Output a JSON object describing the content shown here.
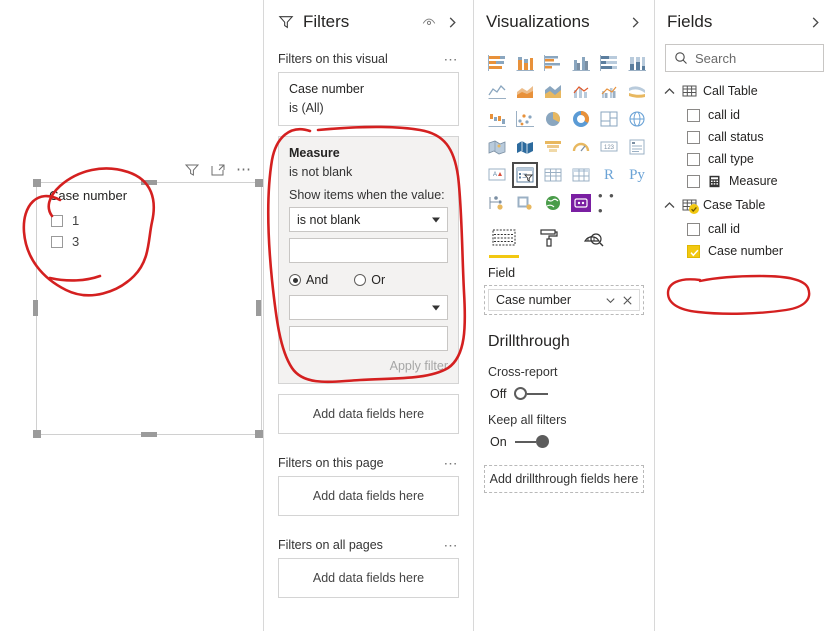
{
  "canvas": {
    "visual_header_icons": [
      "filter-icon",
      "focus-mode-icon",
      "more-options-icon"
    ],
    "slicer": {
      "title": "Case number",
      "items": [
        {
          "label": "1",
          "checked": false
        },
        {
          "label": "3",
          "checked": false
        }
      ]
    }
  },
  "filters": {
    "title": "Filters",
    "header_icons": [
      "eye-icon",
      "expand-chevron-icon"
    ],
    "sections": [
      {
        "label": "Filters on this visual"
      },
      {
        "label": "Filters on this page"
      },
      {
        "label": "Filters on all pages"
      }
    ],
    "visual_cards": [
      {
        "name": "Case number",
        "summary": "is (All)"
      }
    ],
    "expanded_card": {
      "name": "Measure",
      "summary": "is not blank",
      "condition_label": "Show items when the value:",
      "operator1": "is not blank",
      "value1": "",
      "logic": {
        "and_label": "And",
        "or_label": "Or",
        "selected": "And"
      },
      "operator2": "",
      "value2": "",
      "apply_label": "Apply filter"
    },
    "dropzone_label": "Add data fields here",
    "page_dropzone_label": "Add data fields here",
    "all_pages_dropzone_label": "Add data fields here"
  },
  "visualizations": {
    "title": "Visualizations",
    "header_icons": [
      "expand-chevron-icon"
    ],
    "gallery": [
      "stacked-bar-chart",
      "stacked-column-chart",
      "clustered-bar-chart",
      "clustered-column-chart",
      "100-stacked-bar-chart",
      "100-stacked-column-chart",
      "line-chart",
      "area-chart",
      "stacked-area-chart",
      "line-stacked-column-chart",
      "line-clustered-column-chart",
      "ribbon-chart",
      "waterfall-chart",
      "scatter-chart",
      "pie-chart",
      "donut-chart",
      "treemap",
      "map",
      "filled-map",
      "shape-map",
      "funnel",
      "gauge",
      "card",
      "multi-row-card",
      "kpi",
      "slicer",
      "table",
      "matrix",
      "r-script-visual",
      "python-visual",
      "key-influencers",
      "decomposition-tree",
      "arcgis-map",
      "smart-narrative",
      "more-visuals"
    ],
    "selected_visual": "slicer",
    "r_label": "R",
    "py_label": "Py",
    "more_label": "• • •",
    "tabs": [
      {
        "name": "fields-tab",
        "icon": "fields-pane-icon",
        "selected": true
      },
      {
        "name": "format-tab",
        "icon": "paint-roller-icon",
        "selected": false
      },
      {
        "name": "analytics-tab",
        "icon": "analytics-magnifier-icon",
        "selected": false
      }
    ],
    "well": {
      "label": "Field",
      "chip": {
        "text": "Case number",
        "icons": [
          "chevron-down-icon",
          "remove-icon"
        ]
      }
    },
    "drillthrough": {
      "title": "Drillthrough",
      "cross_report": {
        "label": "Cross-report",
        "state": "Off",
        "on": false
      },
      "keep_all_filters": {
        "label": "Keep all filters",
        "state": "On",
        "on": true
      },
      "dropzone_label": "Add drillthrough fields here"
    }
  },
  "fields": {
    "title": "Fields",
    "header_icons": [
      "expand-chevron-icon"
    ],
    "search": {
      "placeholder": "Search",
      "value": ""
    },
    "tables": [
      {
        "name": "Call Table",
        "expanded": true,
        "badge": false,
        "fields": [
          {
            "name": "call id",
            "checked": false,
            "measure": false
          },
          {
            "name": "call status",
            "checked": false,
            "measure": false
          },
          {
            "name": "call type",
            "checked": false,
            "measure": false
          },
          {
            "name": "Measure",
            "checked": false,
            "measure": true
          }
        ]
      },
      {
        "name": "Case Table",
        "expanded": true,
        "badge": true,
        "fields": [
          {
            "name": "call id",
            "checked": false,
            "measure": false
          },
          {
            "name": "Case number",
            "checked": true,
            "measure": false
          }
        ]
      }
    ]
  },
  "annotations": {
    "color": "#d42020",
    "shapes": [
      "circle-slicer-visual",
      "circle-measure-filter-card",
      "circle-case-number-field"
    ]
  },
  "colors": {
    "accent_yellow": "#f2c811",
    "annotation_red": "#d42020",
    "panel_bg": "#f3f2f1",
    "border": "#d4d4d4",
    "text": "#252423"
  }
}
